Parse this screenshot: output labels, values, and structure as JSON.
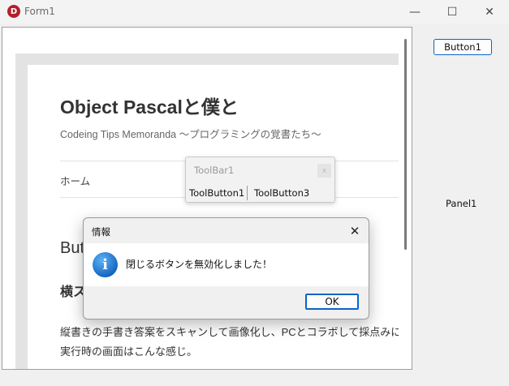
{
  "window": {
    "title": "Form1",
    "app_icon_letter": "D",
    "minimize_glyph": "—",
    "maximize_glyph": "☐",
    "close_glyph": "✕"
  },
  "page": {
    "site_title": "Object Pascalと僕と",
    "site_subtitle": "Codeing Tips Memoranda 〜プログラミングの覚書たち〜",
    "nav_home": "ホーム",
    "post_heading": "Butt",
    "sub_heading": "横ス",
    "body_text": "縦書きの手書き答案をスキャンして画像化し、PCとコラボして採点みに実行時の画面はこんな感じ。"
  },
  "right_panel": {
    "button1_label": "Button1",
    "panel_label": "Panel1"
  },
  "toolbar": {
    "title": "ToolBar1",
    "close_glyph": "x",
    "buttons": [
      "ToolButton1",
      "ToolButton3"
    ]
  },
  "dialog": {
    "title": "情報",
    "close_glyph": "✕",
    "icon_glyph": "i",
    "message": "閉じるボタンを無効化しました！",
    "ok_label": "OK"
  },
  "colors": {
    "accent": "#0a64c8",
    "info_icon": "#1976d2",
    "app_icon": "#b3202a"
  }
}
